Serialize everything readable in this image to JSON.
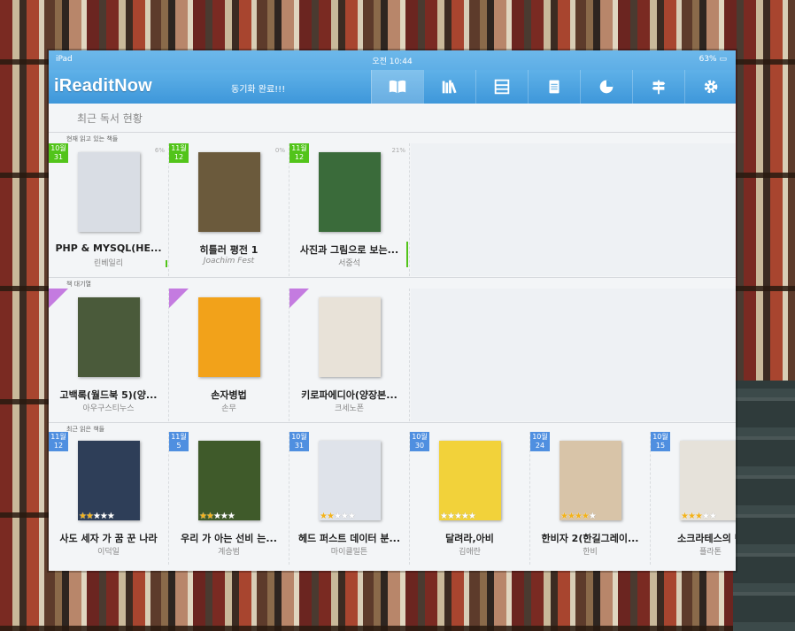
{
  "status": {
    "device": "iPad",
    "time": "오전 10:44",
    "battery": "63%"
  },
  "header": {
    "logo": "iReaditNow",
    "sync_message": "동기화 완료!!!"
  },
  "tabs": [
    {
      "icon": "book-open-icon",
      "active": true
    },
    {
      "icon": "bookshelf-icon",
      "active": false
    },
    {
      "icon": "calendar-grid-icon",
      "active": false
    },
    {
      "icon": "notes-icon",
      "active": false
    },
    {
      "icon": "pie-chart-icon",
      "active": false
    },
    {
      "icon": "signpost-icon",
      "active": false
    },
    {
      "icon": "gear-icon",
      "active": false
    }
  ],
  "section_title": "최근 독서 현황",
  "reading": {
    "label": "현재 읽고 있는 책들",
    "books": [
      {
        "date": "10월 31",
        "progress": "6%",
        "title": "PHP & MYSQL(HE...",
        "author": "린베일리",
        "cover": "#d9dde4"
      },
      {
        "date": "11월 12",
        "progress": "0%",
        "title": "히틀러 평전 1",
        "author": "Joachim Fest",
        "cover": "#6b5a3c"
      },
      {
        "date": "11월 12",
        "progress": "21%",
        "title": "사진과 그림으로 보는...",
        "author": "서중석",
        "cover": "#3a6b3a"
      }
    ]
  },
  "waiting": {
    "label": "책 대기열",
    "books": [
      {
        "title": "고백록(월드북 5)(양...",
        "author": "아우구스티누스",
        "cover": "#4a5a3a"
      },
      {
        "title": "손자병법",
        "author": "손무",
        "cover": "#f2a21a"
      },
      {
        "title": "키로파에디아(양장본...",
        "author": "크세노폰",
        "cover": "#e8e2d8"
      }
    ]
  },
  "recent": {
    "label": "최근 읽은 책들",
    "books": [
      {
        "date": "11월 12",
        "title": "사도 세자 가 꿈 꾼 나라",
        "author": "이덕일",
        "cover": "#2e3e58",
        "rating": 2
      },
      {
        "date": "11월 5",
        "title": "우리 가 아는 선비 는...",
        "author": "계승범",
        "cover": "#3f5a2a",
        "rating": 2
      },
      {
        "date": "10월 31",
        "title": "헤드 퍼스트 데이터 분...",
        "author": "마이클밀튼",
        "cover": "#dfe3ea",
        "rating": 2
      },
      {
        "date": "10월 30",
        "title": "달려라,아비",
        "author": "김애란",
        "cover": "#f2d23a",
        "rating": 0
      },
      {
        "date": "10월 24",
        "title": "한비자 2(한길그레이...",
        "author": "한비",
        "cover": "#d8c4a8",
        "rating": 4
      },
      {
        "date": "10월 15",
        "title": "소크라테스의 변",
        "author": "플라톤",
        "cover": "#e6e2da",
        "rating": 3
      }
    ]
  }
}
